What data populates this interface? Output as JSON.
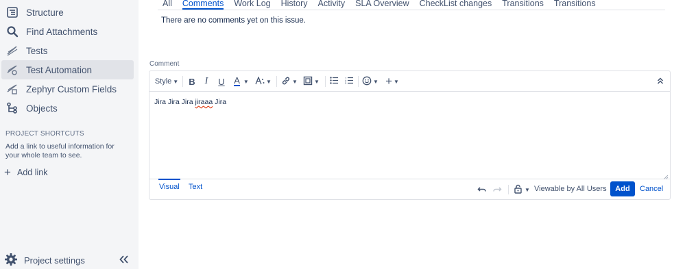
{
  "sidebar": {
    "items": [
      {
        "label": "Structure",
        "icon": "structure-icon"
      },
      {
        "label": "Find Attachments",
        "icon": "search-icon"
      },
      {
        "label": "Tests",
        "icon": "tests-icon"
      },
      {
        "label": "Test Automation",
        "icon": "test-automation-icon",
        "active": true
      },
      {
        "label": "Zephyr Custom Fields",
        "icon": "zephyr-icon"
      },
      {
        "label": "Objects",
        "icon": "objects-icon"
      }
    ],
    "shortcuts_title": "PROJECT SHORTCUTS",
    "shortcuts_desc": "Add a link to useful information for your whole team to see.",
    "add_link": "Add link",
    "project_settings": "Project settings"
  },
  "tabs": [
    {
      "label": "All"
    },
    {
      "label": "Comments",
      "active": true
    },
    {
      "label": "Work Log"
    },
    {
      "label": "History"
    },
    {
      "label": "Activity"
    },
    {
      "label": "SLA Overview"
    },
    {
      "label": "CheckList changes"
    },
    {
      "label": "Transitions"
    },
    {
      "label": "Transitions"
    }
  ],
  "no_comments": "There are no comments yet on this issue.",
  "comment": {
    "label": "Comment",
    "toolbar": {
      "style_label": "Style",
      "bold": "B",
      "italic": "I",
      "underline": "U",
      "text_color": "A"
    },
    "text_before": "Jira Jira Jira ",
    "text_misspelled": "jiraaa",
    "text_after": " Jira",
    "mode_visual": "Visual",
    "mode_text": "Text",
    "viewable": "Viewable by All Users",
    "add": "Add",
    "cancel": "Cancel"
  },
  "colors": {
    "accent": "#0052cc",
    "sidebar_bg": "#f4f5f7",
    "active_bg": "#e1e3e8"
  }
}
